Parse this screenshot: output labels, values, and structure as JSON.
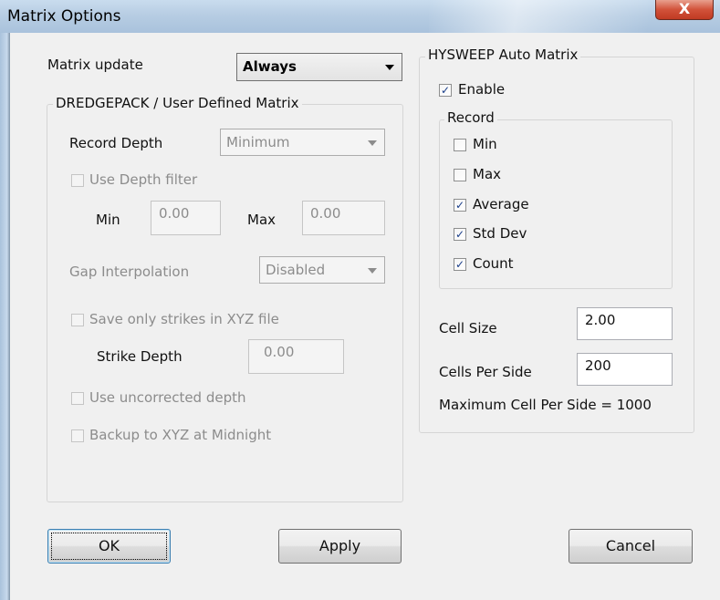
{
  "window": {
    "title": "Matrix Options",
    "close_label": "X"
  },
  "matrix_update": {
    "label": "Matrix update",
    "value": "Always"
  },
  "user_matrix": {
    "title": "DREDGEPACK / User Defined Matrix",
    "record_depth_label": "Record Depth",
    "record_depth_value": "Minimum",
    "use_depth_filter_label": "Use Depth filter",
    "use_depth_filter_checked": false,
    "min_label": "Min",
    "min_value": "0.00",
    "max_label": "Max",
    "max_value": "0.00",
    "gap_label": "Gap Interpolation",
    "gap_value": "Disabled",
    "save_strikes_label": "Save only strikes in XYZ file",
    "save_strikes_checked": false,
    "strike_depth_label": "Strike Depth",
    "strike_depth_value": "0.00",
    "uncorrected_label": "Use uncorrected depth",
    "uncorrected_checked": false,
    "backup_label": "Backup to XYZ at Midnight",
    "backup_checked": false
  },
  "auto_matrix": {
    "title": "HYSWEEP Auto Matrix",
    "enable_label": "Enable",
    "enable_checked": true,
    "record_title": "Record",
    "record_options": [
      {
        "label": "Min",
        "checked": false
      },
      {
        "label": "Max",
        "checked": false
      },
      {
        "label": "Average",
        "checked": true
      },
      {
        "label": "Std Dev",
        "checked": true
      },
      {
        "label": "Count",
        "checked": true
      }
    ],
    "cell_size_label": "Cell Size",
    "cell_size_value": "2.00",
    "cells_per_side_label": "Cells Per Side",
    "cells_per_side_value": "200",
    "max_cell_text": "Maximum Cell Per Side = 1000"
  },
  "buttons": {
    "ok": "OK",
    "apply": "Apply",
    "cancel": "Cancel"
  },
  "icons": {
    "check": "✓"
  }
}
